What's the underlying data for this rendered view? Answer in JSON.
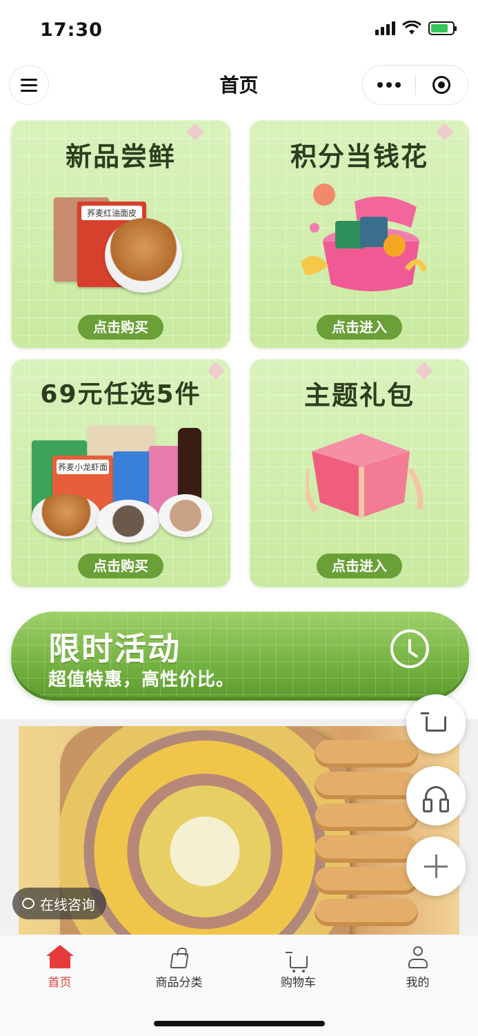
{
  "status_bar": {
    "time": "17:30"
  },
  "navbar": {
    "title": "首页"
  },
  "cards": [
    {
      "title": "新品尝鲜",
      "button": "点击购买",
      "pkg_label": "荞麦红油面皮"
    },
    {
      "title": "积分当钱花",
      "button": "点击进入"
    },
    {
      "title": "69元任选5件",
      "button": "点击购买",
      "pkg_label": "荞麦小龙虾面"
    },
    {
      "title": "主题礼包",
      "button": "点击进入"
    }
  ],
  "promo": {
    "title": "限时活动",
    "subtitle": "超值特惠，高性价比。"
  },
  "consult": {
    "label": "在线咨询"
  },
  "tabbar": {
    "items": [
      {
        "label": "首页",
        "active": true
      },
      {
        "label": "商品分类"
      },
      {
        "label": "购物车"
      },
      {
        "label": "我的"
      }
    ]
  },
  "colors": {
    "accent_green": "#6aa037",
    "tab_active": "#e63b3b"
  }
}
